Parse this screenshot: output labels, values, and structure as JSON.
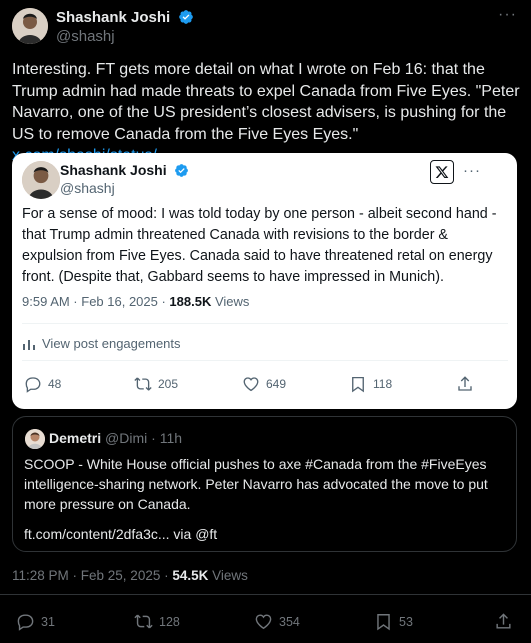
{
  "post": {
    "author_name": "Shashank Joshi",
    "author_handle": "@shashj",
    "text": "Interesting. FT gets more detail on what I wrote on Feb 16: that the Trump admin had made threats to expel Canada from Five Eyes. \"Peter Navarro, one of the US president’s closest advisers, is pushing for the US to remove Canada from the Five Eyes Eyes.\"",
    "link_text": "x.com/shashj/status/…",
    "time": "11:28 PM · Feb 25, 2025 · ",
    "views_count": "54.5K",
    "views_label": "Views",
    "actions": {
      "replies": "31",
      "reposts": "128",
      "likes": "354",
      "bookmarks": "53"
    }
  },
  "embedded": {
    "author_name": "Shashank Joshi",
    "author_handle": "@shashj",
    "text": "For a sense of mood: I was told today by one person - albeit second hand - that Trump admin threatened Canada with revisions to the border & expulsion from Five Eyes. Canada said to have threatened retal on energy front. (Despite that, Gabbard seems to have impressed in Munich).",
    "time": "9:59 AM · Feb 16, 2025 · ",
    "views_count": "188.5K",
    "views_label": "Views",
    "engagements_label": "View post engagements",
    "actions": {
      "replies": "48",
      "reposts": "205",
      "likes": "649",
      "bookmarks": "118"
    }
  },
  "quoted": {
    "author_name": "Demetri",
    "author_handle": "@Dimi",
    "time": "· 11h",
    "text": "SCOOP - White House official pushes to axe #Canada from the #FiveEyes intelligence-sharing network. Peter Navarro has advocated the move to put more pressure on Canada.",
    "link_line": "ft.com/content/2dfa3c... via @ft"
  },
  "colors": {
    "background": "#000000",
    "embed_card": "#ffffff",
    "accent": "#1d9bf0",
    "muted": "#71767b"
  }
}
